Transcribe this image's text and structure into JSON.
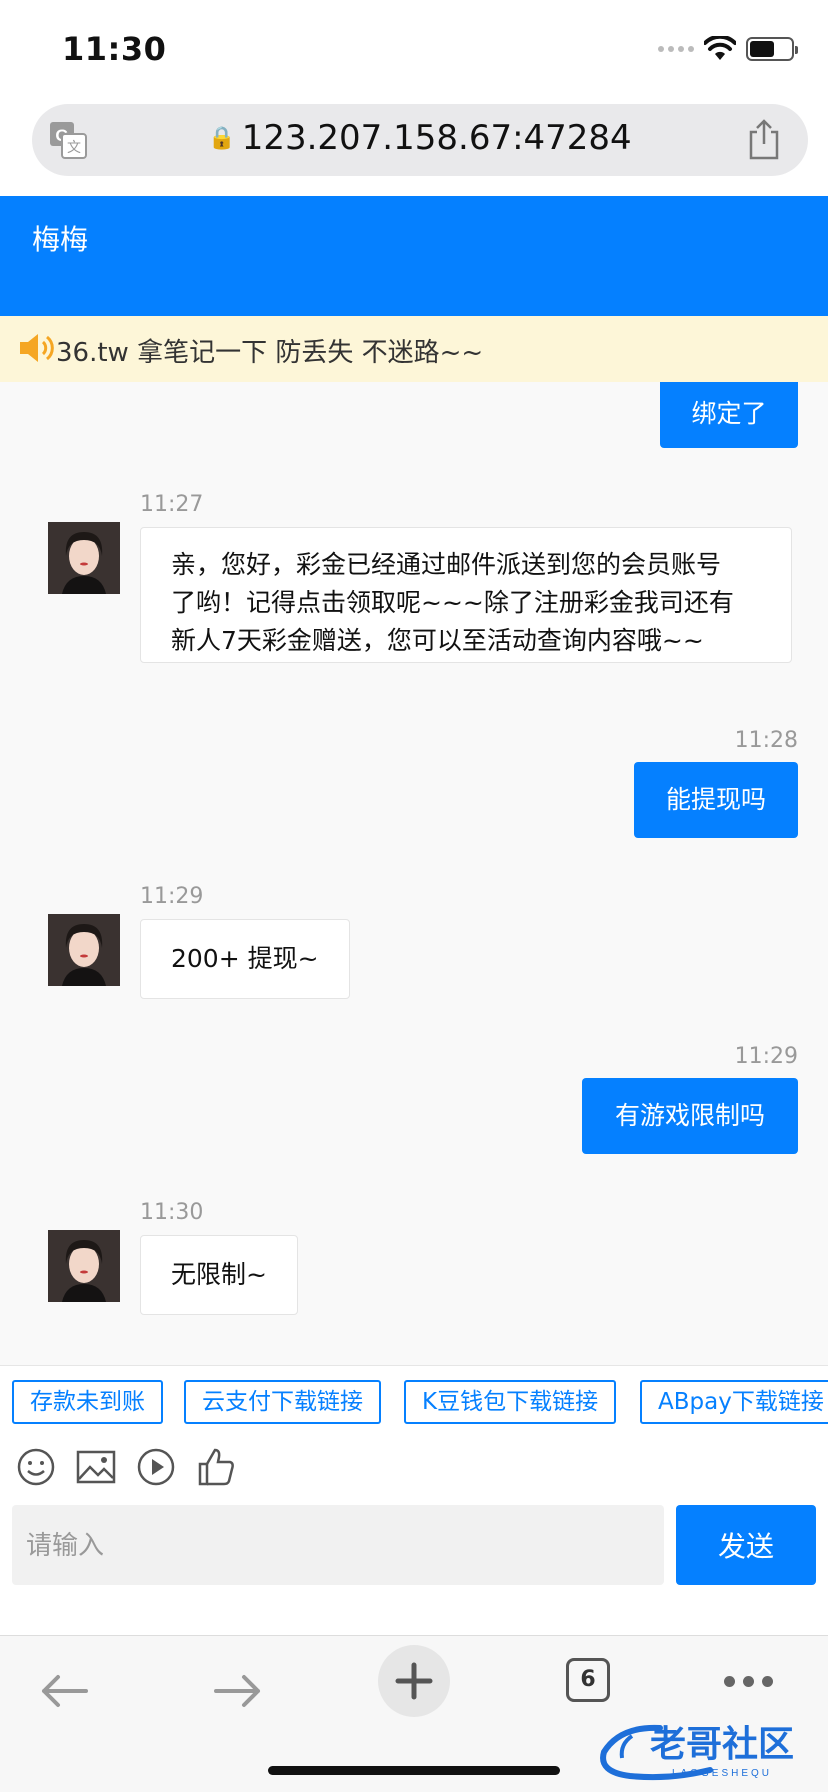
{
  "status_bar": {
    "time": "11:30",
    "battery_level": 0.6
  },
  "browser": {
    "url": "123.207.158.67:47284",
    "tab_count": "6"
  },
  "chat": {
    "title": "梅梅",
    "notice": "36.tw 拿笔记一下 防丢失 不迷路~~",
    "messages": [
      {
        "side": "out",
        "time": "",
        "text": "绑定了"
      },
      {
        "side": "in",
        "time": "11:27",
        "lines": [
          "亲，您好，彩金已经通过邮件派送到您的会员账号",
          "了哟！记得点击领取呢~~~除了注册彩金我司还有",
          "新人7天彩金赠送，您可以至活动查询内容哦~~"
        ]
      },
      {
        "side": "out",
        "time": "11:28",
        "text": "能提现吗"
      },
      {
        "side": "in",
        "time": "11:29",
        "text": "200+ 提现~"
      },
      {
        "side": "out",
        "time": "11:29",
        "text": "有游戏限制吗"
      },
      {
        "side": "in",
        "time": "11:30",
        "text": "无限制~"
      }
    ]
  },
  "quick_replies": [
    "存款未到账",
    "云支付下载链接",
    "K豆钱包下载链接",
    "ABpay下载链接"
  ],
  "input": {
    "placeholder": "请输入",
    "value": "",
    "send_label": "发送"
  },
  "toolbar_icons": [
    "emoji-icon",
    "image-icon",
    "video-icon",
    "thumbs-up-icon"
  ],
  "watermark": {
    "text": "老哥社区",
    "subtext": "LAOGESHEQU"
  },
  "colors": {
    "accent": "#0580ff",
    "notice_bg": "#fdf6d8",
    "chat_bg": "#f9f9f9"
  }
}
